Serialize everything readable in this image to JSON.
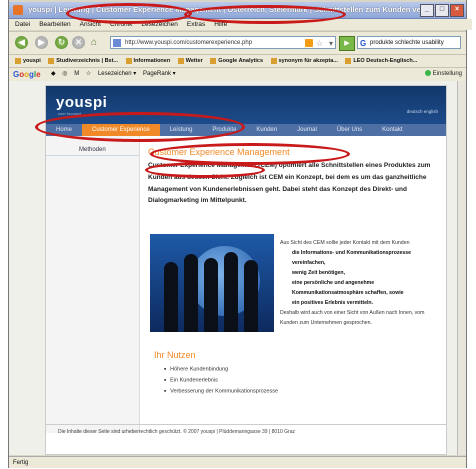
{
  "browser": {
    "window_title": "youspi | Leistung | Customer Experience Management | Österreich, Steiermark | Schnittstellen zum Kunden verbesser... W",
    "menu": [
      "Datei",
      "Bearbeiten",
      "Ansicht",
      "Chronik",
      "Lesezeichen",
      "Extras",
      "Hilfe"
    ],
    "url": "http://www.youspi.com/customerexperience.php",
    "search_value": "produkte schlechte usability",
    "bookmarks": [
      "youspi",
      "Studiverzeichnis | Bst...",
      "Informationen",
      "Wetter",
      "Google Analytics",
      "synonym für akzepta...",
      "LEO Deutsch-Englisch..."
    ],
    "google_toolbar": {
      "logo": "Google",
      "icons": [
        "◆",
        "◎",
        "M",
        "☆",
        "Lesezeichen ▾",
        "PageRank ▾"
      ],
      "settings": "Einstellung"
    },
    "status": "Fertig"
  },
  "site": {
    "logo": "youspi",
    "logo_sub": "user focused",
    "lang": "deutsch english",
    "nav": [
      "Home",
      "Customer Experience",
      "Leistung",
      "Produkte",
      "Kunden",
      "Journal",
      "Über Uns",
      "Kontakt"
    ],
    "nav_active": 1,
    "sidebar_item": "Methoden",
    "heading": "Customer Experience Management",
    "intro": "Customer Experience Management (CEM) optimiert alle Schnittstellen eines Produktes zum Kunden aus dessen Sicht. Zugleich ist CEM ein Konzept, bei dem es um das ganzheitliche Management von Kundenerlebnissen geht. Dabei steht das Konzept des Direkt- und Dialogmarketing im Mittelpunkt.",
    "right_intro": "Aus Sicht des CEM sollte jeder Kontakt mit dem Kunden",
    "right_points": [
      "die Informations- und Kommunikationsprozesse vereinfachen,",
      "wenig Zeit benötigen,",
      "eine persönliche und angenehme Kommunikationsatmosphäre schaffen, sowie",
      "ein positives Erlebnis vermitteln."
    ],
    "right_outro": "Deshalb wird auch von einer Sicht von Außen nach Innen, vom Kunden zum Unternehmen gesprochen.",
    "nutzen_title": "Ihr Nutzen",
    "nutzen": [
      "Höhere Kundenbindung",
      "Ein Kundenerlebnis",
      "Verbesserung der Kommunikationsprozesse"
    ],
    "footer": "Die Inhalte dieser Seite sind urheberrechtlich geschützt. © 2007 youspi | Plüddemanngasse 39 | 8010 Graz"
  },
  "colors": {
    "highlight_ring": "#c81a1a",
    "accent_orange": "#f08a28",
    "header_blue": "#12376a"
  }
}
